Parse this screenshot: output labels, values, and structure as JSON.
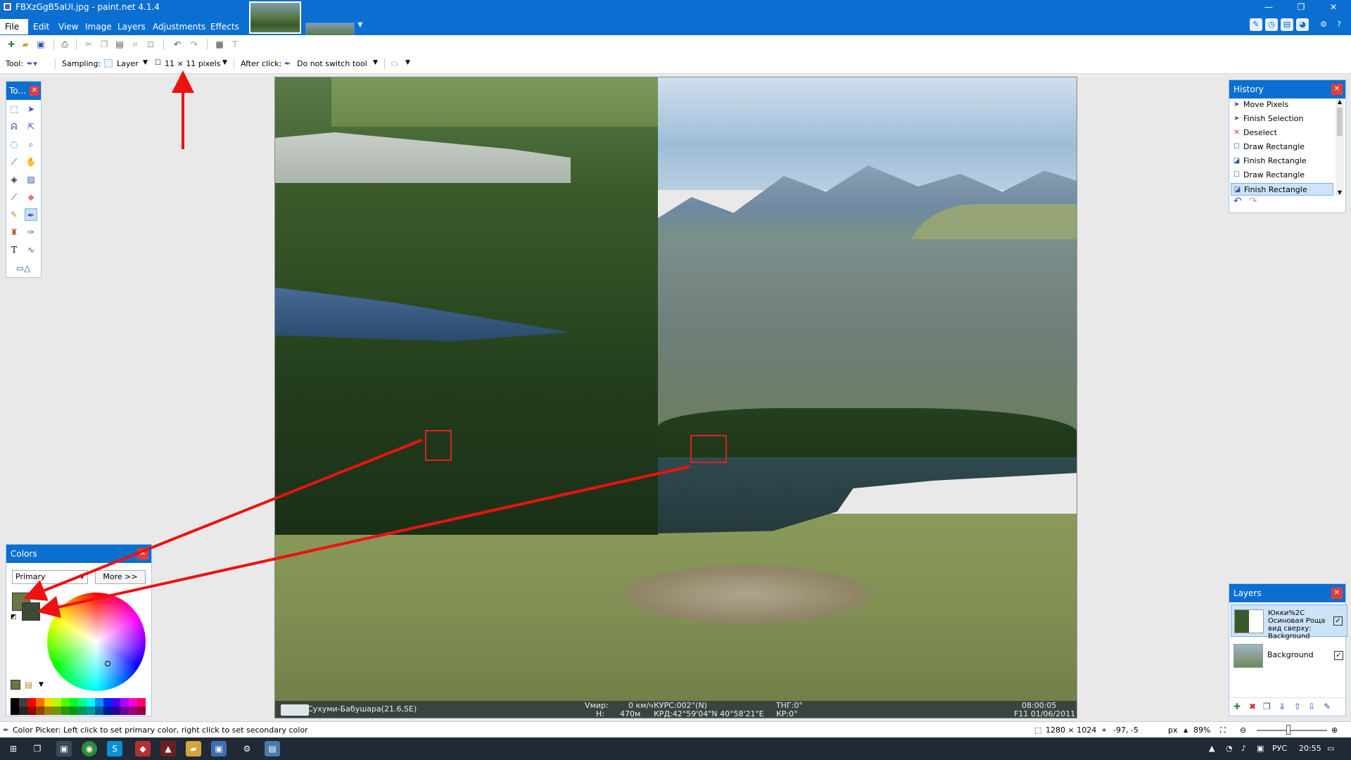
{
  "window": {
    "title": "FBXzGgB5aUI.jpg - paint.net 4.1.4",
    "minimize": "—",
    "maximize": "❐",
    "close": "✕"
  },
  "menu": [
    "File",
    "Edit",
    "View",
    "Image",
    "Layers",
    "Adjustments",
    "Effects"
  ],
  "toolbar2": {
    "tool_label": "Tool:",
    "sampling_label": "Sampling:",
    "sampling_value": "Layer",
    "size_value": "11 × 11 pixels",
    "after_click_label": "After click:",
    "after_click_value": "Do not switch tool"
  },
  "tools_panel": {
    "title": "To..."
  },
  "history": {
    "title": "History",
    "items": [
      {
        "label": "Move Pixels",
        "icon": "move-icon"
      },
      {
        "label": "Finish Selection",
        "icon": "selection-icon"
      },
      {
        "label": "Deselect",
        "icon": "deselect-icon"
      },
      {
        "label": "Draw Rectangle",
        "icon": "rectangle-icon"
      },
      {
        "label": "Finish Rectangle",
        "icon": "rectangle-icon"
      },
      {
        "label": "Draw Rectangle",
        "icon": "rectangle-icon"
      },
      {
        "label": "Finish Rectangle",
        "icon": "rectangle-icon"
      }
    ],
    "selected_index": 6
  },
  "colors": {
    "title": "Colors",
    "mode": "Primary",
    "more_button": "More >>",
    "primary_color": "#6b7742",
    "secondary_color": "#3f4a35",
    "palette": [
      "#000000",
      "#404040",
      "#ff0000",
      "#ff6a00",
      "#ffd800",
      "#b6ff00",
      "#4cff00",
      "#00ff21",
      "#00ff90",
      "#00ffff",
      "#0094ff",
      "#0026ff",
      "#4800ff",
      "#b200ff",
      "#ff00dc",
      "#ff006e"
    ]
  },
  "layers": {
    "title": "Layers",
    "items": [
      {
        "name": "Юкки%2С Осиновая Роща вид сверху: Background",
        "visible": "✓"
      },
      {
        "name": "Background",
        "visible": "✓"
      }
    ]
  },
  "hud": {
    "location": "Сухуми-Бабушара(21.6,SE)",
    "vumir": "Vмир:",
    "speed": "0 км/ч",
    "h": "H:",
    "height": "470м",
    "course": "КУРС:002°(N)",
    "coords": "КРД:42°59'04\"N 40°58'21\"E",
    "thr": "ТНГ:0°",
    "kr": "КР:0°",
    "time": "08:00:05",
    "date": "F11 01/06/2011"
  },
  "status": {
    "hint": "Color Picker: Left click to set primary color, right click to set secondary color",
    "image_size": "1280 × 1024",
    "cursor": "-97, -5",
    "units": "px",
    "zoom": "89%"
  },
  "taskbar": {
    "lang": "РУС",
    "time": "20:55"
  }
}
